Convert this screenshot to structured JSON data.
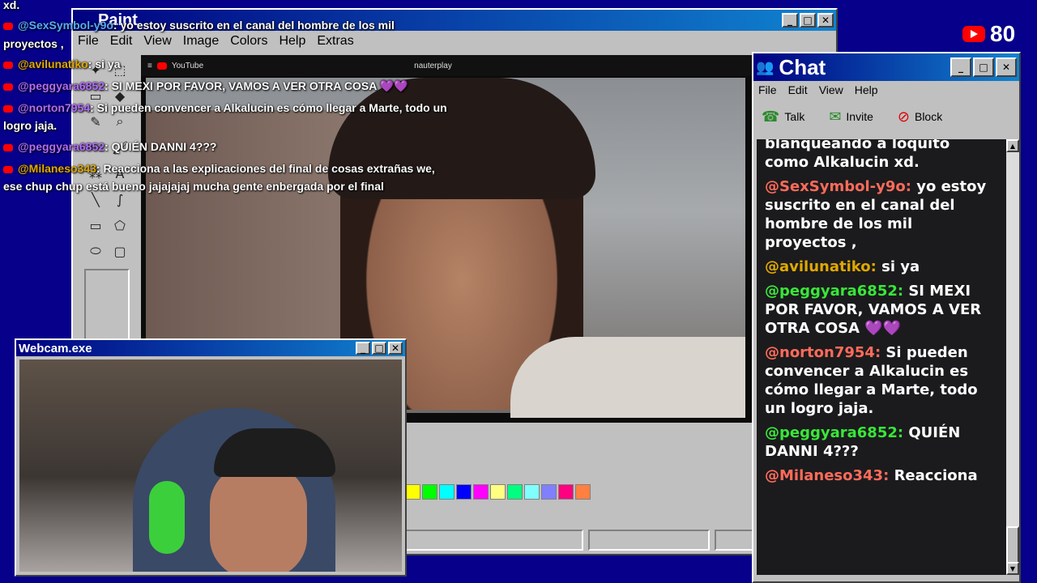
{
  "paint": {
    "title": "Paint",
    "menu": [
      "File",
      "Edit",
      "View",
      "Image",
      "Colors",
      "Help",
      "Extras"
    ],
    "video_tab_left": "YouTube",
    "video_tab_mid": "nauterplay",
    "palette": [
      "#ffff00",
      "#00ff00",
      "#00ffff",
      "#0000ff",
      "#ff00ff",
      "#ffff80",
      "#00ff80",
      "#80ffff",
      "#8080ff",
      "#ff0080",
      "#ff8040"
    ]
  },
  "overlay_chat": {
    "top": "xd.",
    "messages": [
      {
        "user": "@SexSymbol-y9o",
        "text": ": yo estoy suscrito en el canal del hombre de los mil",
        "cont": "proyectos ,"
      },
      {
        "user": "@avilunatiko",
        "text": ": si ya"
      },
      {
        "user": "@peggyara6852",
        "text": ": SI MEXI POR FAVOR, VAMOS A VER OTRA COSA 💜💜"
      },
      {
        "user": "@norton7954",
        "text": ": Si pueden convencer a Alkalucin es cómo llegar a Marte, todo un",
        "cont": "logro jaja."
      },
      {
        "user": "@peggyara6852",
        "text": ": QUIÉN DANNI 4???"
      },
      {
        "user": "@Milaneso343",
        "text": ": Reacciona a las explicaciones del final de cosas extrañas we,",
        "cont": "ese chup chup está bueno jajajajaj mucha gente enbergada por el final"
      }
    ]
  },
  "webcam": {
    "title": "Webcam.exe"
  },
  "chat": {
    "title": "Chat",
    "menu": [
      "File",
      "Edit",
      "View",
      "Help"
    ],
    "toolbar": {
      "talk": "Talk",
      "invite": "Invite",
      "block": "Block"
    },
    "messages": [
      {
        "user": "",
        "text": "blanqueando a loquito",
        "color": "#ffffff"
      },
      {
        "user": "",
        "text": "como Alkalucin xd.",
        "color": "#ffffff"
      },
      {
        "user": "@SexSymbol-y9o:",
        "text": "yo estoy suscrito en el canal del hombre de los mil proyectos ,",
        "color": "#ff6b5a"
      },
      {
        "user": "@avilunatiko:",
        "text": "si ya",
        "color": "#e0a800"
      },
      {
        "user": "@peggyara6852:",
        "text": "SI MEXI POR FAVOR, VAMOS A VER OTRA COSA 💜💜",
        "color": "#39e639"
      },
      {
        "user": "@norton7954:",
        "text": "Si pueden convencer a Alkalucin es cómo llegar a Marte, todo un logro jaja.",
        "color": "#ff6b5a"
      },
      {
        "user": "@peggyara6852:",
        "text": "QUIÉN DANNI 4???",
        "color": "#39e639"
      },
      {
        "user": "@Milaneso343:",
        "text": "Reacciona",
        "color": "#ff6b5a"
      }
    ]
  },
  "viewer_count": "80"
}
